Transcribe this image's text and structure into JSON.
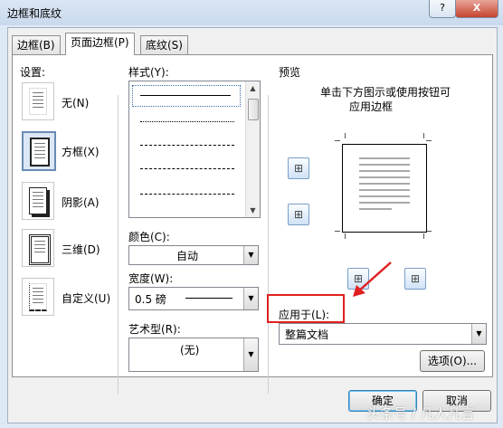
{
  "window": {
    "title": "边框和底纹",
    "help_label": "?",
    "close_label": "X"
  },
  "tabs": [
    {
      "label": "边框(B)"
    },
    {
      "label": "页面边框(P)"
    },
    {
      "label": "底纹(S)"
    }
  ],
  "settings": {
    "heading": "设置:",
    "options": [
      {
        "label": "无(N)",
        "icon": "no-border-icon"
      },
      {
        "label": "方框(X)",
        "icon": "box-border-icon",
        "selected": true
      },
      {
        "label": "阴影(A)",
        "icon": "shadow-border-icon"
      },
      {
        "label": "三维(D)",
        "icon": "3d-border-icon"
      },
      {
        "label": "自定义(U)",
        "icon": "custom-border-icon"
      }
    ]
  },
  "style": {
    "heading": "样式(Y):"
  },
  "color": {
    "heading": "颜色(C):",
    "value": "自动"
  },
  "width": {
    "heading": "宽度(W):",
    "value": "0.5 磅"
  },
  "art": {
    "heading": "艺术型(R):",
    "value": "(无)"
  },
  "preview": {
    "heading": "预览",
    "hint_line1": "单击下方图示或使用按钮可",
    "hint_line2": "应用边框"
  },
  "apply_to": {
    "heading": "应用于(L):",
    "value": "整篇文档"
  },
  "buttons": {
    "options": "选项(O)...",
    "ok": "确定",
    "cancel": "取消"
  },
  "watermark": "头条号 / 凡人凡言",
  "colors": {
    "highlight": "#e02020",
    "accent": "#3c7fb1"
  }
}
